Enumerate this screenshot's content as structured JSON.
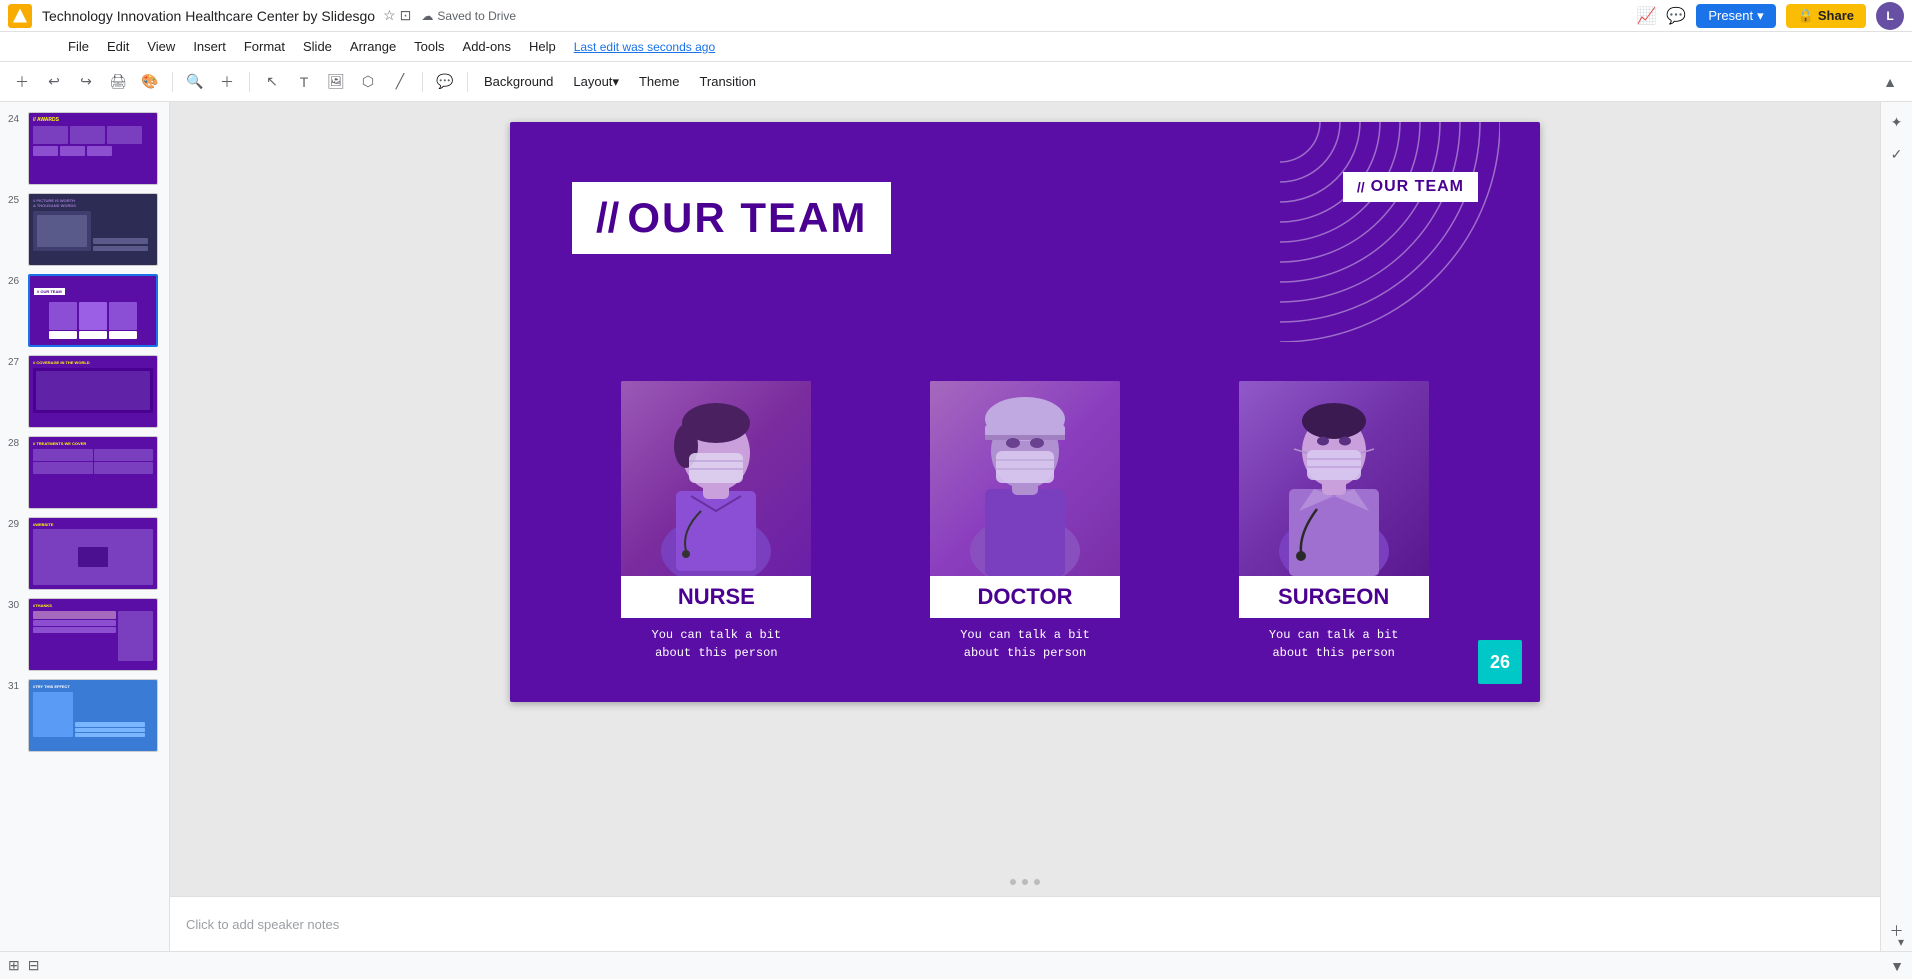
{
  "app": {
    "logo_color": "#f9ab00",
    "doc_title": "Technology Innovation Healthcare Center by Slidesgo",
    "saved_status": "Saved to Drive",
    "last_edit": "Last edit was seconds ago"
  },
  "menu": {
    "items": [
      "File",
      "Edit",
      "View",
      "Insert",
      "Format",
      "Slide",
      "Arrange",
      "Tools",
      "Add-ons",
      "Help"
    ]
  },
  "toolbar": {
    "background_btn": "Background",
    "layout_btn": "Layout",
    "theme_btn": "Theme",
    "transition_btn": "Transition"
  },
  "header": {
    "present_btn": "Present",
    "share_btn": "Share",
    "avatar_initials": "L"
  },
  "slide": {
    "title_slashes": "//",
    "title_text": "OUR TEAM",
    "top_right_slashes": "//",
    "top_right_label": "OUR TEAM",
    "page_number": "26",
    "team_members": [
      {
        "role": "NURSE",
        "description": "You can talk a bit\nabout this person"
      },
      {
        "role": "DOCTOR",
        "description": "You can talk a bit\nabout this person"
      },
      {
        "role": "SURGEON",
        "description": "You can talk a bit\nabout this person"
      }
    ]
  },
  "sidebar": {
    "slides": [
      {
        "num": "24",
        "label": "//AWARDS"
      },
      {
        "num": "25",
        "label": "//PICTURE IS WORTH A THOUSAND WORDS"
      },
      {
        "num": "26",
        "label": "//OUR TEAM",
        "active": true
      },
      {
        "num": "27",
        "label": "//COVERAGE IN THE WORLD"
      },
      {
        "num": "28",
        "label": "//TREATMENTS WE COVER"
      },
      {
        "num": "29",
        "label": "//WEBSITE"
      },
      {
        "num": "30",
        "label": "//THANKS"
      },
      {
        "num": "31",
        "label": "//TRY THIS EFFECT"
      }
    ]
  },
  "speaker_notes": {
    "placeholder": "Click to add speaker notes"
  }
}
